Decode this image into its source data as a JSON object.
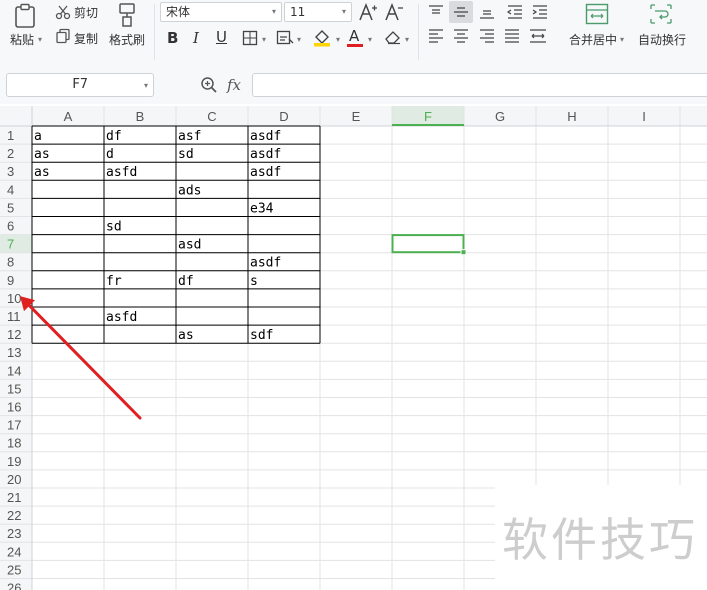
{
  "toolbar": {
    "paste_label": "粘贴",
    "cut_label": "剪切",
    "copy_label": "复制",
    "format_painter_label": "格式刷",
    "font_name": "宋体",
    "font_size": "11",
    "font_color": "#e02020",
    "fill_color": "#ffd400",
    "merge_center_label": "合并居中",
    "wrap_text_label": "自动换行"
  },
  "formula_bar": {
    "cell_reference": "F7",
    "function_label": "fx",
    "formula_value": ""
  },
  "sheet": {
    "columns": [
      "A",
      "B",
      "C",
      "D",
      "E",
      "F",
      "G",
      "H",
      "I"
    ],
    "rows": [
      "1",
      "2",
      "3",
      "4",
      "5",
      "6",
      "7",
      "8",
      "9",
      "10",
      "11",
      "12",
      "13",
      "14",
      "15",
      "16",
      "17",
      "18",
      "19",
      "20",
      "21",
      "22",
      "23",
      "24",
      "25",
      "26"
    ],
    "selected_cell": {
      "column": "F",
      "row": "7"
    },
    "selection_color": "#4caf50",
    "cells": [
      [
        "a",
        "df",
        "asf",
        "asdf"
      ],
      [
        "as",
        "d",
        "sd",
        "asdf"
      ],
      [
        "as",
        "asfd",
        "",
        "asdf"
      ],
      [
        "",
        "",
        "ads",
        ""
      ],
      [
        "",
        "",
        "",
        "e34"
      ],
      [
        "",
        "sd",
        "",
        ""
      ],
      [
        "",
        "",
        "asd",
        ""
      ],
      [
        "",
        "",
        "",
        "asdf"
      ],
      [
        "",
        "fr",
        "df",
        "s"
      ],
      [
        "",
        "",
        "",
        ""
      ],
      [
        "",
        "asfd",
        "",
        ""
      ],
      [
        "",
        "",
        "as",
        "sdf"
      ]
    ]
  },
  "annotation": {
    "arrow_color": "#e02020",
    "target_row": "10"
  },
  "watermark": {
    "text": "软件技巧"
  }
}
